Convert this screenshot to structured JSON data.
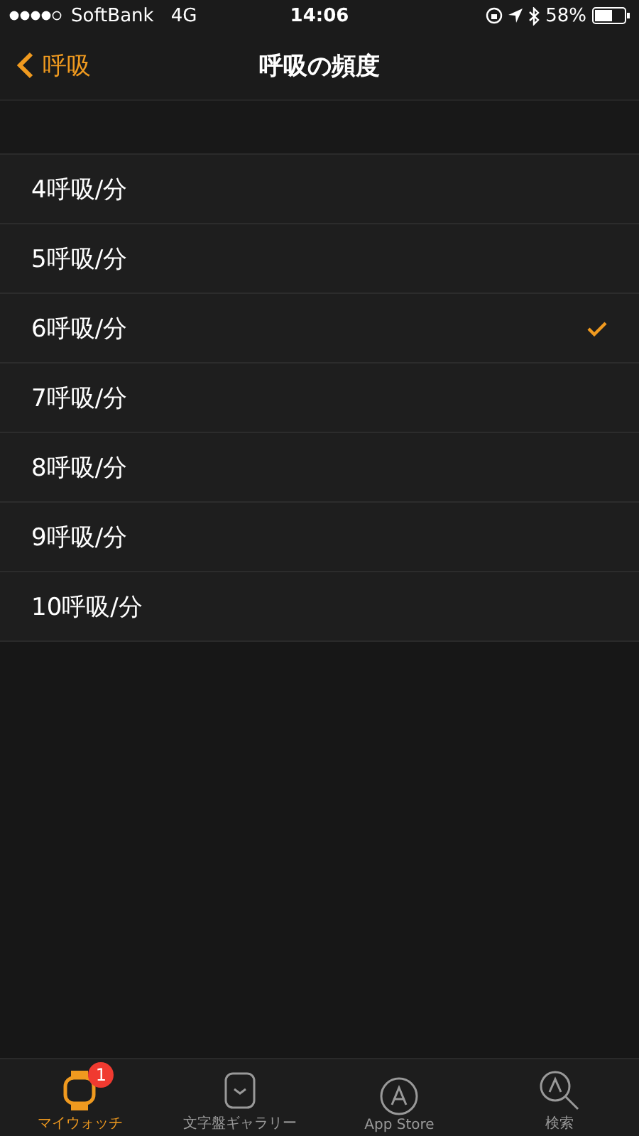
{
  "status_bar": {
    "carrier": "SoftBank",
    "network": "4G",
    "time": "14:06",
    "battery": "58%"
  },
  "nav": {
    "back": "呼吸",
    "title": "呼吸の頻度"
  },
  "options": [
    {
      "label": "4呼吸/分",
      "selected": false
    },
    {
      "label": "5呼吸/分",
      "selected": false
    },
    {
      "label": "6呼吸/分",
      "selected": true
    },
    {
      "label": "7呼吸/分",
      "selected": false
    },
    {
      "label": "8呼吸/分",
      "selected": false
    },
    {
      "label": "9呼吸/分",
      "selected": false
    },
    {
      "label": "10呼吸/分",
      "selected": false
    }
  ],
  "tabs": [
    {
      "label": "マイウォッチ",
      "selected": true,
      "badge": "1"
    },
    {
      "label": "文字盤ギャラリー",
      "selected": false
    },
    {
      "label": "App Store",
      "selected": false
    },
    {
      "label": "検索",
      "selected": false
    }
  ]
}
